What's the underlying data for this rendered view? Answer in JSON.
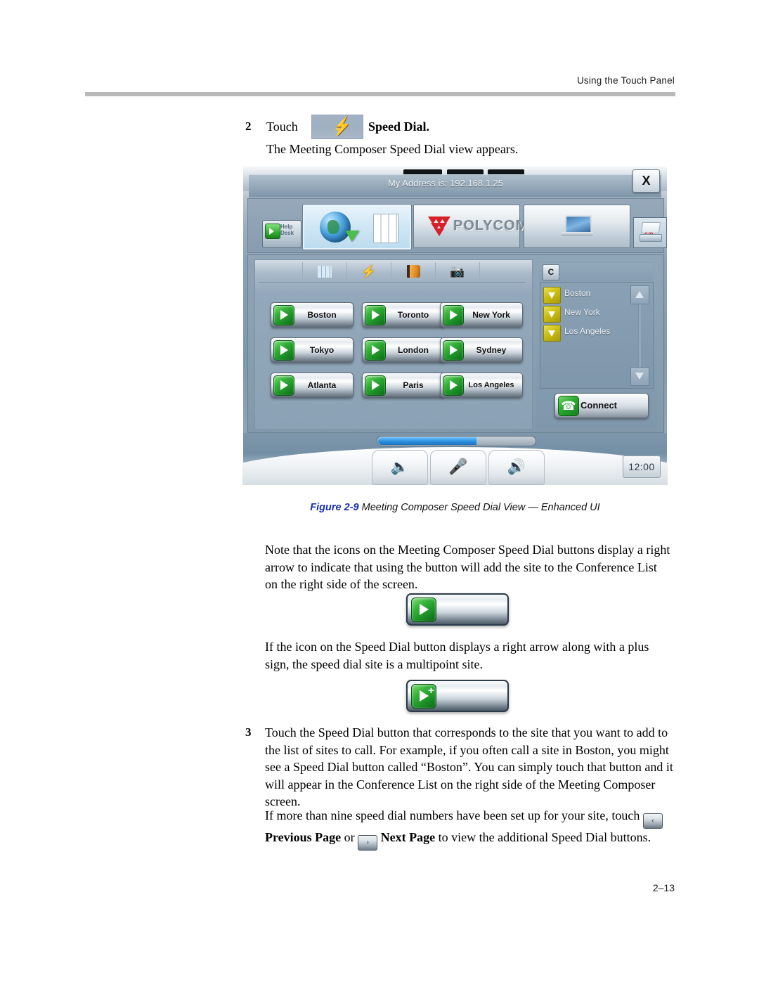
{
  "header": {
    "running_head": "Using the Touch Panel"
  },
  "step2": {
    "number": "2",
    "lead": "Touch",
    "icon_name": "speed-dial-lightning-icon",
    "label": "Speed Dial.",
    "subtext": "The Meeting Composer Speed Dial view appears."
  },
  "touch_panel": {
    "address_bar": "My Address is: 192.168.1.25",
    "close_label": "X",
    "help_desk": {
      "line1": "Help",
      "line2": "Desk"
    },
    "top_tiles": [
      {
        "name": "globe-keypad-tile",
        "label": ""
      },
      {
        "name": "polycom-logo-tile",
        "label": "POLYCOM"
      },
      {
        "name": "laptop-tile",
        "label": ""
      },
      {
        "name": "rolodex-tile",
        "label": ""
      }
    ],
    "tabs": [
      {
        "name": "tab-blank",
        "icon": "blank-icon"
      },
      {
        "name": "tab-keypad",
        "icon": "keypad-icon"
      },
      {
        "name": "tab-speed-dial",
        "icon": "lightning-icon"
      },
      {
        "name": "tab-address-book",
        "icon": "address-book-icon"
      },
      {
        "name": "tab-camera",
        "icon": "camera-icon"
      },
      {
        "name": "tab-blank-2",
        "icon": "blank-icon"
      }
    ],
    "speed_dial_buttons": [
      "Boston",
      "Toronto",
      "New York",
      "Tokyo",
      "London",
      "Sydney",
      "Atlanta",
      "Paris",
      "Los Angeles"
    ],
    "conference_list": {
      "header_button": "C",
      "items": [
        "Boston",
        "New York",
        "Los Angeles"
      ],
      "scroll_up_icon": "triangle-up-icon",
      "scroll_down_icon": "triangle-down-icon"
    },
    "connect_button": {
      "label": "Connect",
      "icon": "phone-up-icon"
    },
    "bottom_bar": {
      "volume_down_icon": "volume-down-icon",
      "mute_icon": "mute-microphone-icon",
      "volume_up_icon": "volume-up-icon",
      "clock": "12:00",
      "progress_percent": 62
    }
  },
  "figure": {
    "label": "Figure 2-9",
    "caption": "Meeting Composer Speed Dial View — Enhanced UI"
  },
  "body": {
    "p1": "Note that the icons on the Meeting Composer Speed Dial buttons display a right arrow to indicate that using the button will add the site to the Conference List on the right side of the screen.",
    "p2": "If the icon on the Speed Dial button displays a right arrow along with a plus sign, the speed dial site is a multipoint site.",
    "step3_number": "3",
    "p3": "Touch the Speed Dial button that corresponds to the site that you want to add to the list of sites to call. For example, if you often call a site in Boston, you might see a Speed Dial button called “Boston”. You can simply touch that button and it will appear in the Conference List on the right side of the Meeting Composer screen.",
    "p4_a": "If more than nine speed dial numbers have been set up for your site, touch",
    "prev_btn_glyph": "‹",
    "p4_prev": "Previous Page",
    "p4_or": "or",
    "next_btn_glyph": "›",
    "p4_next": "Next Page",
    "p4_b": "to view the additional Speed Dial buttons."
  },
  "footer": {
    "page_number": "2–13"
  },
  "colors": {
    "accent_blue": "#1a2fb0",
    "rule_gray": "#b9b9b9",
    "green_button": "#1a8c25",
    "yellow_item": "#cdbe13",
    "polycom_red": "#d8202a",
    "progress_blue": "#2a8fe0"
  }
}
